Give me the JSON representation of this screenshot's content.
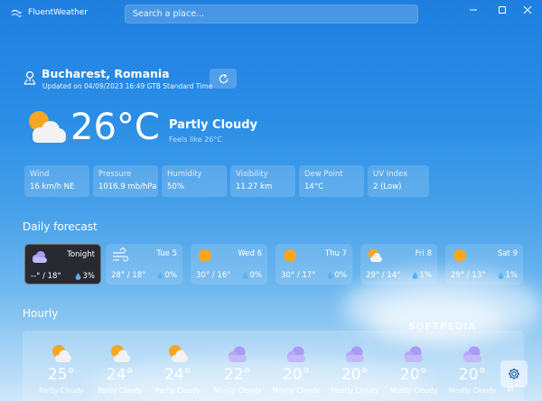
{
  "app": {
    "title": "FluentWeather"
  },
  "search": {
    "placeholder": "Search a place..."
  },
  "location": {
    "city": "Bucharest, Romania",
    "updated": "Updated on 04/09/2023 16:49 GTB Standard Time"
  },
  "current": {
    "temperature": "26°C",
    "condition": "Partly Cloudy",
    "feels_like": "Feels like 26°C",
    "icon": "partly-cloudy-icon"
  },
  "stats": [
    {
      "label": "Wind",
      "value": "16 km/h NE"
    },
    {
      "label": "Pressure",
      "value": "1016.9 mb/hPa"
    },
    {
      "label": "Humidity",
      "value": "50%"
    },
    {
      "label": "Visibility",
      "value": "11.27 km"
    },
    {
      "label": "Dew Point",
      "value": "14°C"
    },
    {
      "label": "UV Index",
      "value": "2 (Low)"
    }
  ],
  "daily": {
    "title": "Daily forecast",
    "days": [
      {
        "name": "Tonight",
        "range": "--° / 18°",
        "rain": "3%",
        "icon": "cloudy-night-icon"
      },
      {
        "name": "Tue 5",
        "range": "28° / 18°",
        "rain": "0%",
        "icon": "windy-icon"
      },
      {
        "name": "Wed 6",
        "range": "30° / 16°",
        "rain": "0%",
        "icon": "sun-icon"
      },
      {
        "name": "Thu 7",
        "range": "30° / 17°",
        "rain": "0%",
        "icon": "sun-icon"
      },
      {
        "name": "Fri 8",
        "range": "29° / 14°",
        "rain": "1%",
        "icon": "partly-cloudy-icon"
      },
      {
        "name": "Sat 9",
        "range": "29° / 13°",
        "rain": "1%",
        "icon": "sun-icon"
      }
    ]
  },
  "hourly": {
    "title": "Hourly",
    "hours": [
      {
        "temp": "25°",
        "condition": "Partly Cloudy",
        "icon": "partly-cloudy-icon"
      },
      {
        "temp": "24°",
        "condition": "Partly Cloudy",
        "icon": "partly-cloudy-icon"
      },
      {
        "temp": "24°",
        "condition": "Partly Cloudy",
        "icon": "partly-cloudy-icon"
      },
      {
        "temp": "22°",
        "condition": "Mostly Cloudy",
        "icon": "cloudy-night-icon"
      },
      {
        "temp": "20°",
        "condition": "Mostly Cloudy",
        "icon": "cloudy-night-icon"
      },
      {
        "temp": "20°",
        "condition": "Mostly Cloudy",
        "icon": "cloudy-night-icon"
      },
      {
        "temp": "20°",
        "condition": "Mostly Cloudy",
        "icon": "cloudy-night-icon"
      },
      {
        "temp": "20°",
        "condition": "Mostly Cloudy",
        "icon": "cloudy-night-icon"
      },
      {
        "temp": "",
        "condition": "M",
        "icon": ""
      }
    ]
  },
  "watermark": "SOFTPEDIA",
  "colors": {
    "sun": "#f5a623",
    "night_cloud": "#8a7ff0",
    "selected_card": "#272a30"
  }
}
